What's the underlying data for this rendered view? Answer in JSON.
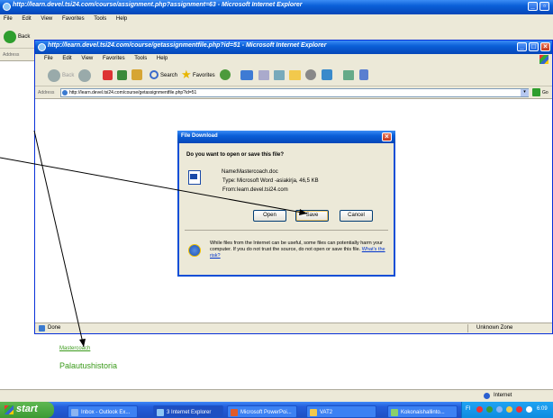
{
  "back_window": {
    "title": "http://learn.devel.tsi24.com/course/assignment.php?assignment=63 - Microsoft Internet Explorer",
    "menu": [
      "File",
      "Edit",
      "View",
      "Favorites",
      "Tools",
      "Help"
    ],
    "back_label": "Back",
    "address_label": "Address"
  },
  "front_window": {
    "title": "http://learn.devel.tsi24.com/course/getassignmentfile.php?id=51 - Microsoft Internet Explorer",
    "menu": [
      "File",
      "Edit",
      "View",
      "Favorites",
      "Tools",
      "Help"
    ],
    "toolbar": {
      "back": "Back",
      "search": "Search",
      "favorites": "Favorites"
    },
    "address_label": "Address",
    "address_value": "http://learn.devel.tsi24.com/course/getassignmentfile.php?id=51",
    "go_label": "Go",
    "status_left": "Done",
    "status_zone": "Unknown Zone"
  },
  "dialog": {
    "title": "File Download",
    "question": "Do you want to open or save this file?",
    "name_label": "Name:",
    "name_value": "Mastercoach.doc",
    "type_label": "Type:",
    "type_value": "Microsoft Word -asiakirja, 46,5 KB",
    "from_label": "From:",
    "from_value": "learn.devel.tsi24.com",
    "open_label": "Open",
    "save_label": "Save",
    "cancel_label": "Cancel",
    "warning": "While files from the Internet can be useful, some files can potentially harm your computer. If you do not trust the source, do not open or save this file.",
    "warning_link": "What's the risk?"
  },
  "back_page": {
    "link_mastercoach": "Mastercoach",
    "link_history": "Palautushistoria",
    "status_zone": "Internet"
  },
  "taskbar": {
    "start": "start",
    "items": [
      "Inbox - Outlook Ex...",
      "3 Internet Explorer",
      "Microsoft PowerPoi...",
      "VAT2",
      "Kokonaishallinto..."
    ],
    "clock": "6:09"
  },
  "colors": {
    "xp_blue": "#0a5fd8",
    "taskbar": "#245edb",
    "start_green": "#3c9a34",
    "link_green": "#3a9a1a"
  }
}
